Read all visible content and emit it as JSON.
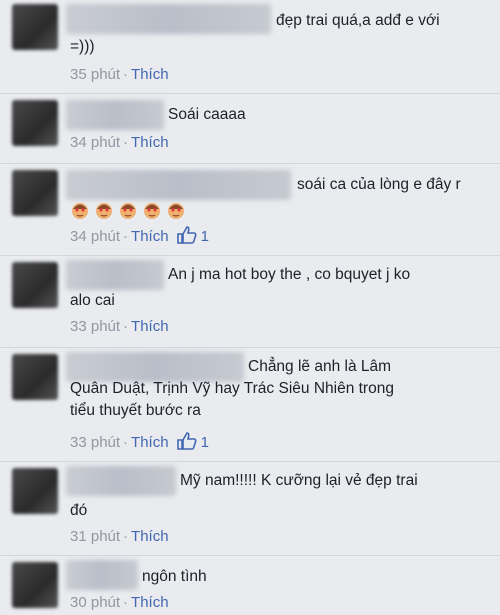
{
  "comments": [
    {
      "lines": [
        "đẹp trai quá,a adđ e với",
        "=)))"
      ],
      "time": "35 phút",
      "like_label": "Thích",
      "likes": ""
    },
    {
      "lines": [
        "Soái caaaa"
      ],
      "time": "34 phút",
      "like_label": "Thích",
      "likes": ""
    },
    {
      "lines": [
        "soái ca của lòng e đây r"
      ],
      "time": "34 phút",
      "like_label": "Thích",
      "likes": "1"
    },
    {
      "lines": [
        "An j ma hot boy the , co bquyet j ko",
        "alo cai"
      ],
      "time": "33 phút",
      "like_label": "Thích",
      "likes": ""
    },
    {
      "lines": [
        "Chẳng lẽ anh là Lâm",
        "Quân Duật, Trịnh Vỹ hay Trác Siêu Nhiên trong",
        "tiểu thuyết bước ra"
      ],
      "time": "33 phút",
      "like_label": "Thích",
      "likes": "1"
    },
    {
      "lines": [
        "Mỹ nam!!!!! K cưỡng lại vẻ đẹp trai",
        "đó"
      ],
      "time": "31 phút",
      "like_label": "Thích",
      "likes": ""
    },
    {
      "lines": [
        "ngôn tình"
      ],
      "time": "30 phút",
      "like_label": "Thích",
      "likes": ""
    }
  ],
  "separator": "·",
  "icons": {
    "like": "thumbs-up-icon",
    "emoji": "heart-eyes-emoji-icon"
  },
  "colors": {
    "link": "#4267b2",
    "meta": "#9197a3",
    "text": "#1d2129",
    "background": "#e9ebee"
  }
}
